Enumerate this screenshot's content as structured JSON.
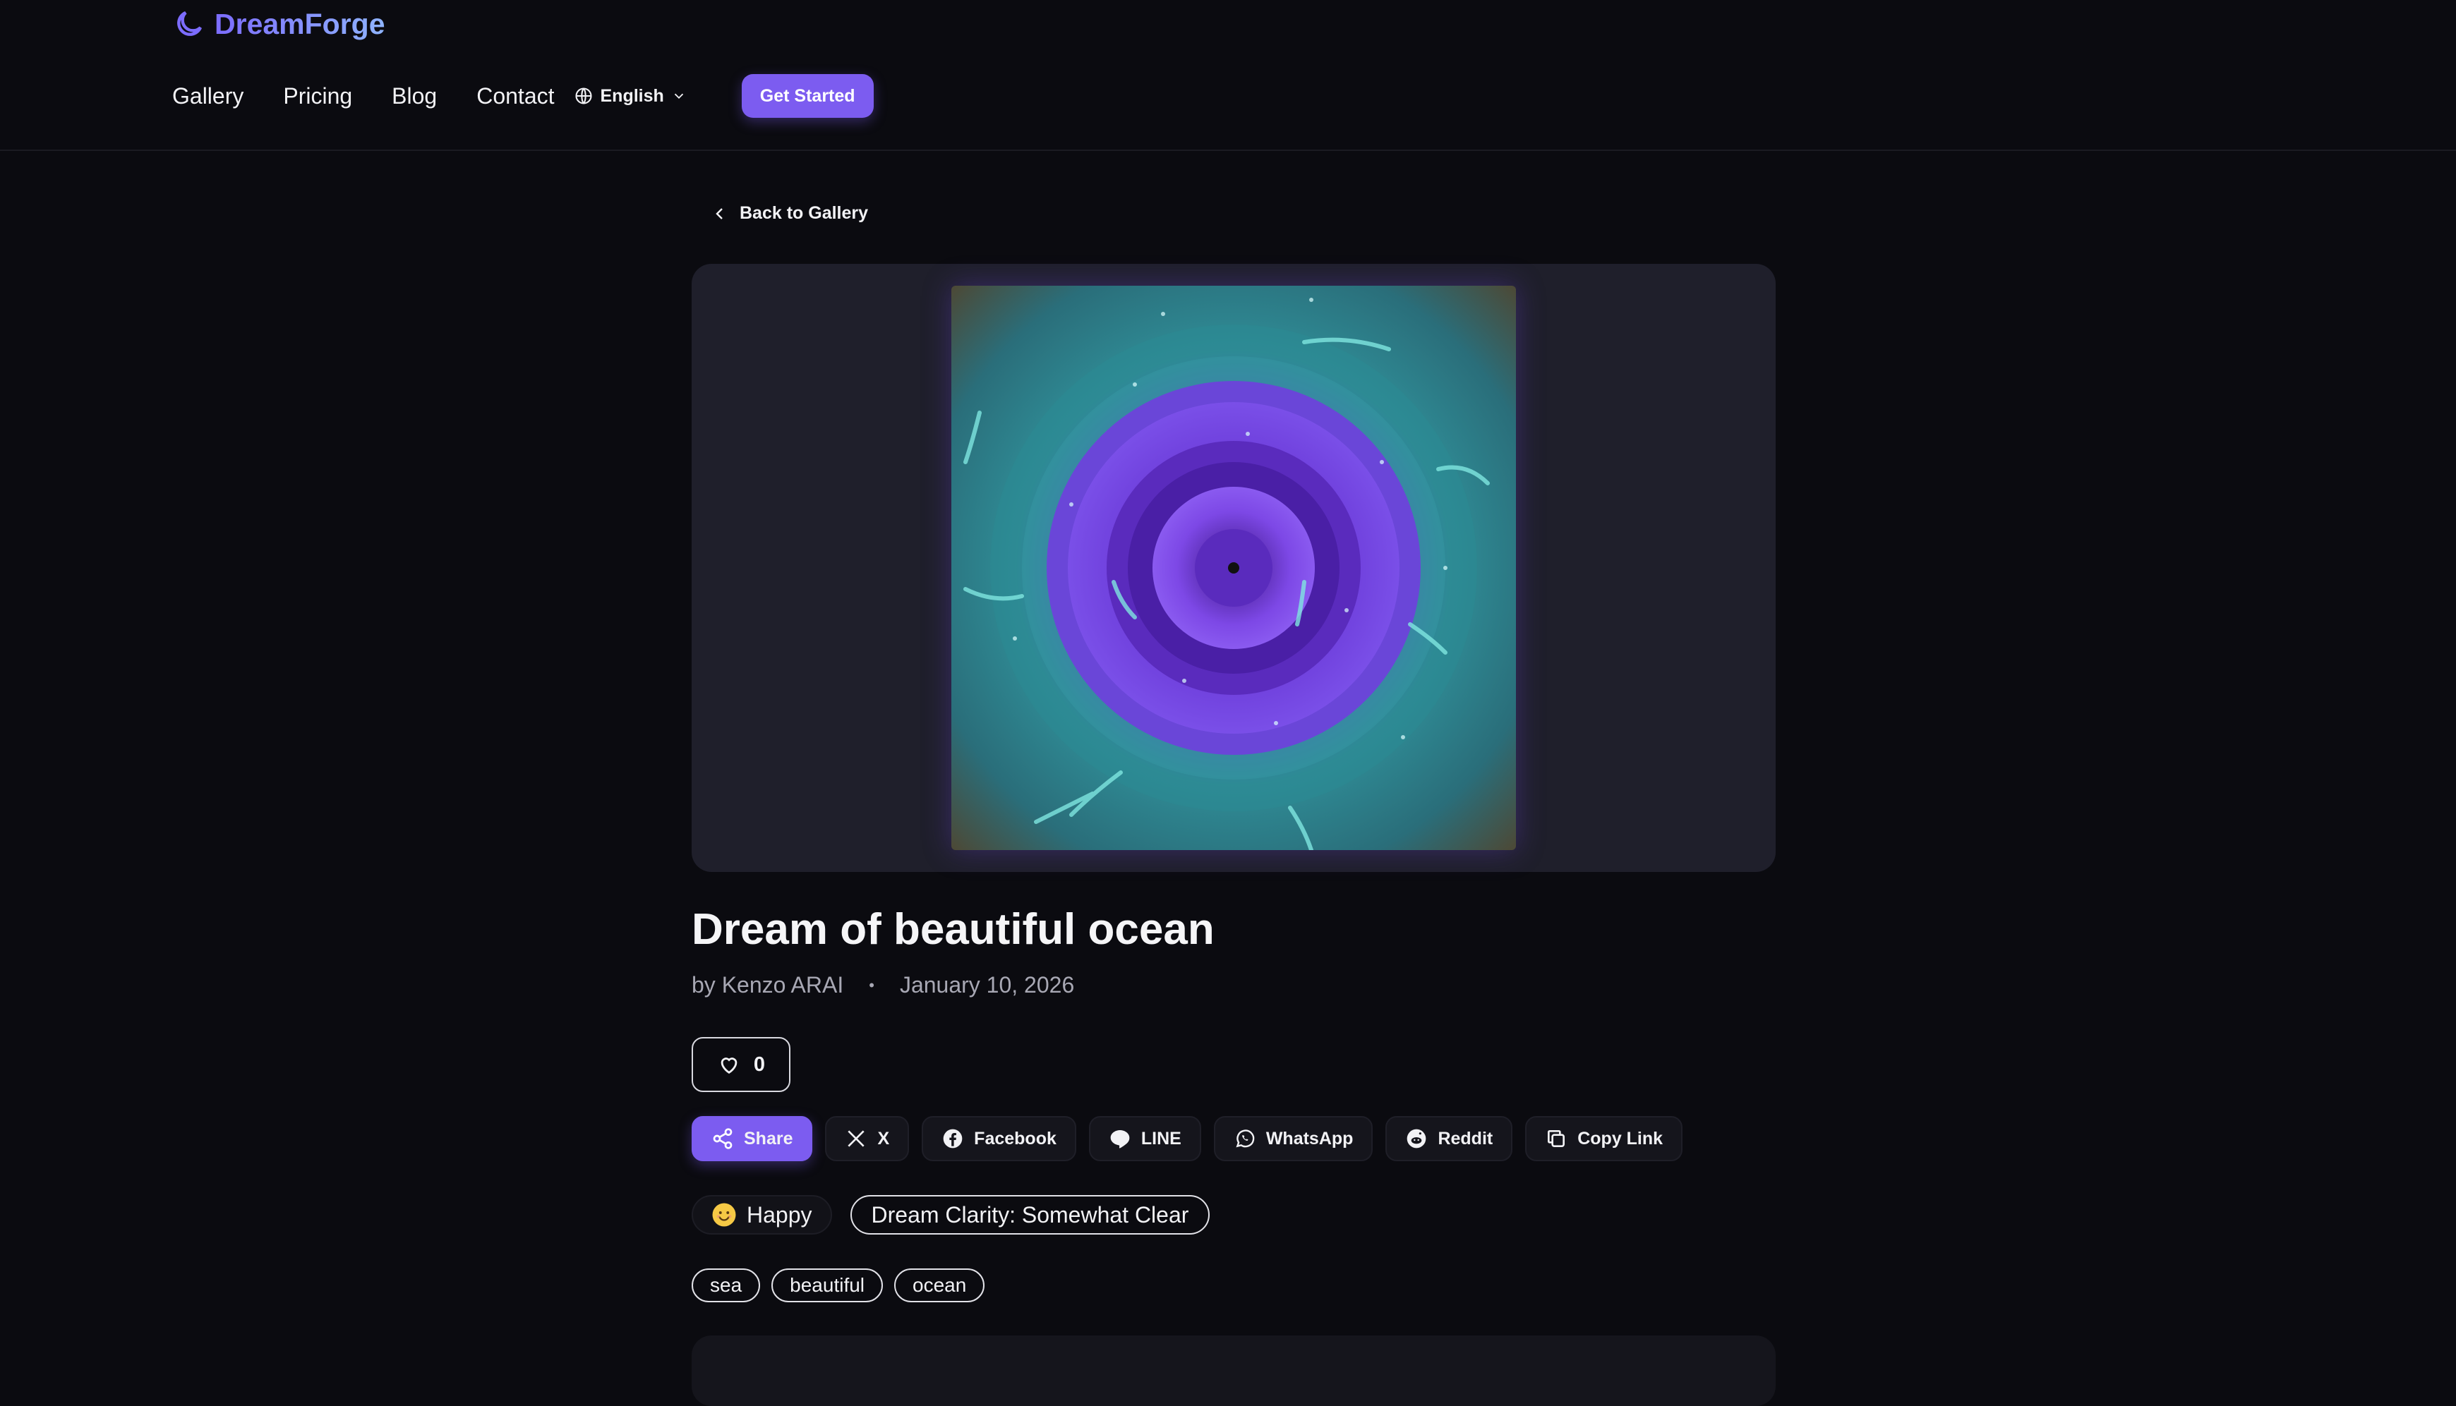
{
  "brand": {
    "name": "DreamForge",
    "accent": "#7c5cf0"
  },
  "nav": {
    "items": [
      "Gallery",
      "Pricing",
      "Blog",
      "Contact"
    ],
    "language": "English",
    "cta": "Get Started"
  },
  "back_link": "Back to Gallery",
  "dream": {
    "title": "Dream of beautiful ocean",
    "author": "by Kenzo ARAI",
    "separator": "•",
    "date": "January 10, 2026",
    "likes": "0"
  },
  "share": {
    "primary": "Share",
    "buttons": [
      "X",
      "Facebook",
      "LINE",
      "WhatsApp",
      "Reddit",
      "Copy Link"
    ]
  },
  "mood": {
    "label": "Happy",
    "icon": "smile-emoji-icon"
  },
  "clarity": "Dream Clarity: Somewhat Clear",
  "tags": [
    "sea",
    "beautiful",
    "ocean"
  ]
}
